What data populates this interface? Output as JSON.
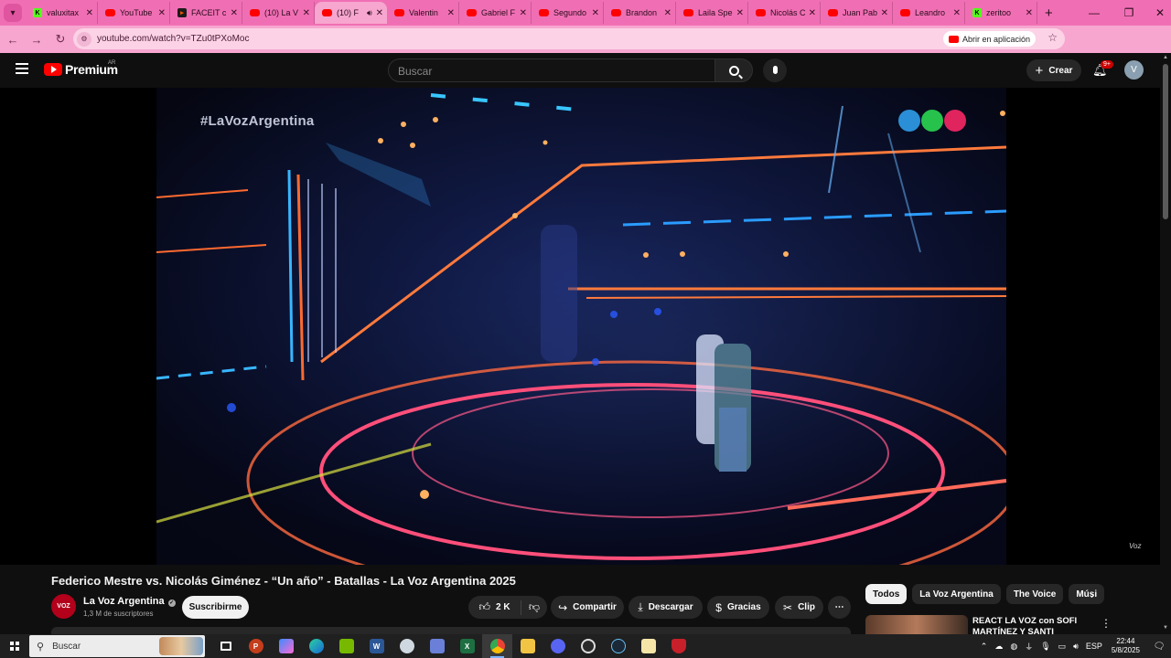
{
  "browser": {
    "tabs": [
      {
        "icon": "kick-icon",
        "favicon": "k",
        "title": "valuxitax",
        "active": false,
        "audio": false
      },
      {
        "icon": "youtube-icon",
        "favicon": "yt",
        "title": "YouTube",
        "active": false,
        "audio": false
      },
      {
        "icon": "faceit-icon",
        "favicon": "faceit",
        "title": "FACEIT c",
        "active": false,
        "audio": false
      },
      {
        "icon": "youtube-icon",
        "favicon": "yt",
        "title": "(10) La V",
        "active": false,
        "audio": false
      },
      {
        "icon": "youtube-icon",
        "favicon": "yt",
        "title": "(10) F",
        "active": true,
        "audio": true
      },
      {
        "icon": "youtube-icon",
        "favicon": "yt",
        "title": "Valentin",
        "active": false,
        "audio": false
      },
      {
        "icon": "youtube-icon",
        "favicon": "yt",
        "title": "Gabriel F",
        "active": false,
        "audio": false
      },
      {
        "icon": "youtube-icon",
        "favicon": "yt",
        "title": "Segundo",
        "active": false,
        "audio": false
      },
      {
        "icon": "youtube-icon",
        "favicon": "yt",
        "title": "Brandon",
        "active": false,
        "audio": false
      },
      {
        "icon": "youtube-icon",
        "favicon": "yt",
        "title": "Laila Spe",
        "active": false,
        "audio": false
      },
      {
        "icon": "youtube-icon",
        "favicon": "yt",
        "title": "Nicolás C",
        "active": false,
        "audio": false
      },
      {
        "icon": "youtube-icon",
        "favicon": "yt",
        "title": "Juan Pab",
        "active": false,
        "audio": false
      },
      {
        "icon": "youtube-icon",
        "favicon": "yt",
        "title": "Leandro",
        "active": false,
        "audio": false
      },
      {
        "icon": "kick-icon",
        "favicon": "k",
        "title": "zeritoo",
        "active": false,
        "audio": false
      }
    ],
    "url": "youtube.com/watch?v=TZu0tPXoMoc",
    "open_in_app": "Abrir en aplicación",
    "profile_initial": "V",
    "accent": "#f06fb4"
  },
  "youtube": {
    "logo_text": "Premium",
    "country_code": "AR",
    "search_placeholder": "Buscar",
    "create_label": "Crear",
    "notifications_badge": "9+",
    "avatar_initial": "V"
  },
  "video": {
    "overlay_hashtag": "#LaVozArgentina",
    "logo_dots": [
      "#2a8fd6",
      "#27c24c",
      "#e0245e"
    ],
    "watermark": "Voz"
  },
  "info": {
    "title": "Federico Mestre vs. Nicolás Giménez - “Un año” - Batallas - La Voz Argentina 2025",
    "channel_name": "La Voz Argentina",
    "channel_avatar_text": "VOZ",
    "subscribers": "1,3 M de suscriptores",
    "subscribe_label": "Suscribirme",
    "likes": "2 K",
    "share_label": "Compartir",
    "download_label": "Descargar",
    "thanks_label": "Gracias",
    "clip_label": "Clip"
  },
  "sidebar": {
    "chips": [
      {
        "label": "Todos",
        "selected": true
      },
      {
        "label": "La Voz Argentina",
        "selected": false
      },
      {
        "label": "The Voice",
        "selected": false
      },
      {
        "label": "Músi",
        "selected": false
      }
    ],
    "rec_title": "REACT LA VOZ con SOFI MARTÍNEZ Y SANTI TALLEDO"
  },
  "taskbar": {
    "search_label": "Buscar",
    "language": "ESP",
    "time": "22:44",
    "date": "5/8/2025"
  }
}
